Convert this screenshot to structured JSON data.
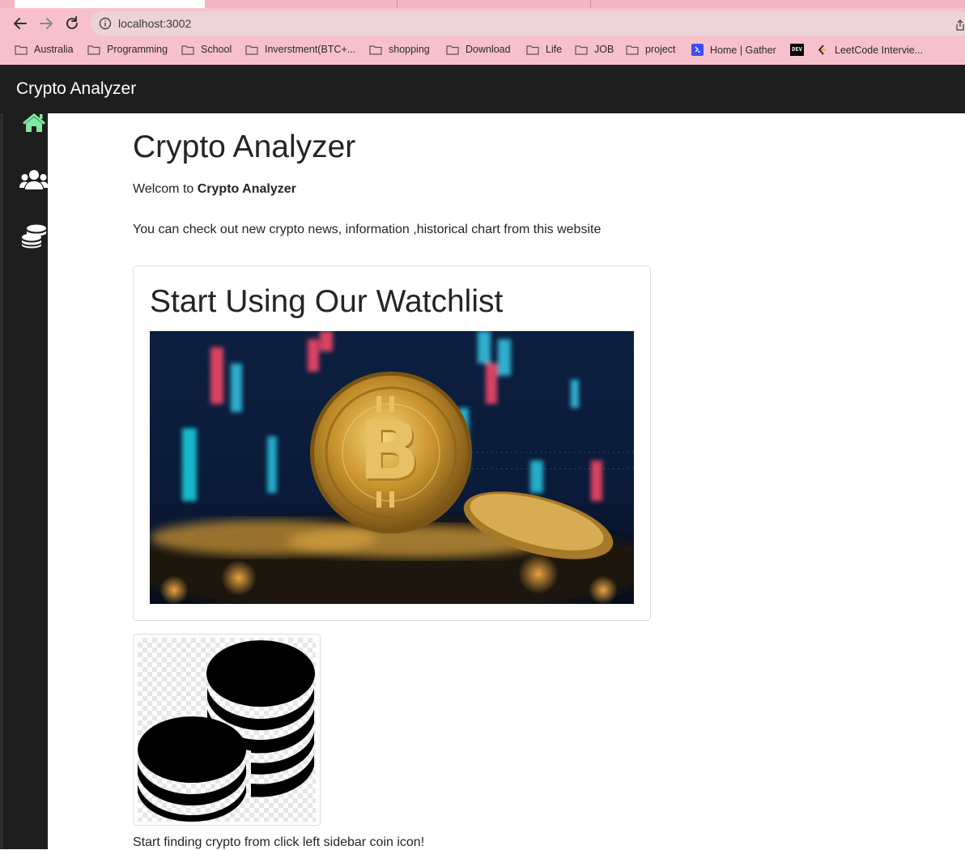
{
  "browser": {
    "url": "localhost:3002",
    "bookmarks": [
      {
        "label": "Australia",
        "icon": "folder-icon"
      },
      {
        "label": "Programming",
        "icon": "folder-icon"
      },
      {
        "label": "School",
        "icon": "folder-icon"
      },
      {
        "label": "Inverstment(BTC+...",
        "icon": "folder-icon"
      },
      {
        "label": "shopping",
        "icon": "folder-icon"
      },
      {
        "label": "Download",
        "icon": "folder-icon"
      },
      {
        "label": "Life",
        "icon": "folder-icon"
      },
      {
        "label": "JOB",
        "icon": "folder-icon"
      },
      {
        "label": "project",
        "icon": "folder-icon"
      },
      {
        "label": "Home | Gather",
        "icon": "gather-icon"
      },
      {
        "label": "",
        "icon": "dev-icon"
      },
      {
        "label": "LeetCode Intervie...",
        "icon": "leetcode-icon"
      }
    ],
    "dev_badge": "DEV"
  },
  "navbar": {
    "brand": "Crypto Analyzer"
  },
  "sidebar": {
    "items": [
      {
        "icon": "home-icon",
        "active": true,
        "color": "#7ee8a2"
      },
      {
        "icon": "users-icon",
        "active": false,
        "color": "#ffffff"
      },
      {
        "icon": "coins-icon",
        "active": false,
        "color": "#ffffff"
      }
    ]
  },
  "main": {
    "title": "Crypto Analyzer",
    "welcome_prefix": "Welcom to",
    "welcome_bold": "Crypto Analyzer",
    "description": "You can check out new crypto news, information ,historical chart from this website",
    "card": {
      "title": "Start Using Our Watchlist",
      "image": "bitcoin-photo"
    },
    "coin_image": "coins-stack-icon",
    "footer_hint": "Start finding crypto from click left sidebar coin icon!"
  },
  "colors": {
    "navbar": "#1e1e1e",
    "browser_chrome": "#f7c1cb",
    "active_icon": "#7ee8a2"
  }
}
